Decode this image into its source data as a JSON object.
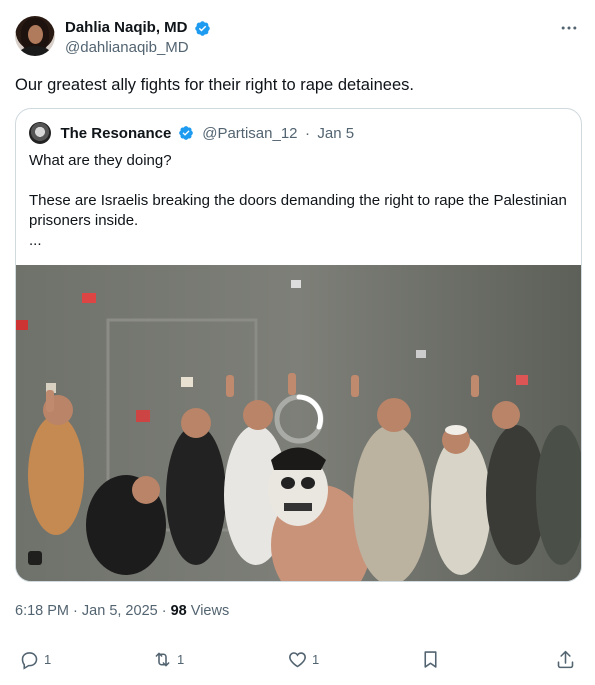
{
  "tweet": {
    "display_name": "Dahlia Naqib, MD",
    "handle": "@dahlianaqib_MD",
    "text": "Our greatest ally fights for their right to rape detainees.",
    "more_icon": "more-horizontal-icon",
    "verified_color": "#1d9bf0"
  },
  "quote": {
    "display_name": "The Resonance",
    "handle": "@Partisan_12",
    "separator": "·",
    "date": "Jan 5",
    "line1": "What are they doing?",
    "line2": "These are Israelis breaking the doors demanding the right to rape the Palestinian prisoners inside.",
    "ellipsis": "..."
  },
  "media": {
    "type": "video",
    "state": "loading",
    "icon": "loading-spinner-icon"
  },
  "meta": {
    "time": "6:18 PM",
    "separator1": "·",
    "date": "Jan 5, 2025",
    "separator2": "·",
    "views_count": "98",
    "views_label": "Views"
  },
  "actions": {
    "reply_count": "1",
    "repost_count": "1",
    "like_count": "1"
  }
}
